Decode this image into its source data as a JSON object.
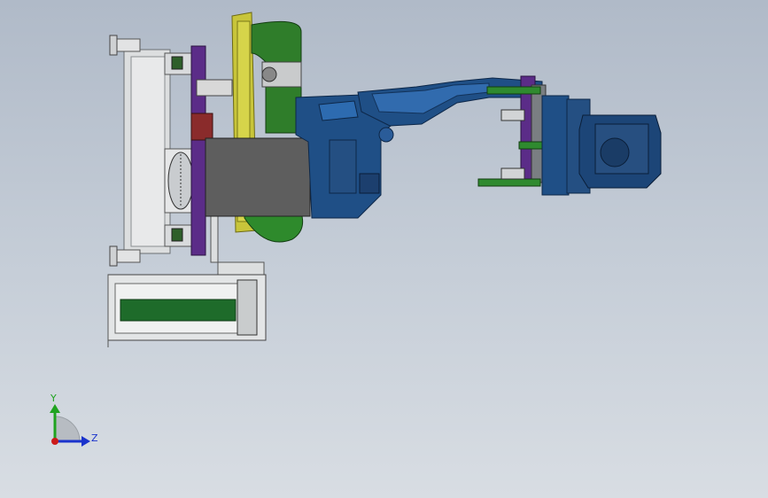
{
  "view": {
    "background_top": "#b0bac8",
    "background_bottom": "#d8dde3"
  },
  "triad": {
    "y_label": "Y",
    "z_label": "Z",
    "y_color": "#1fa31f",
    "z_color": "#1a33cc",
    "x_color": "#cc1a1a"
  },
  "colors": {
    "robot_blue": "#1f4f86",
    "gray_box": "#5e5e5e",
    "yellow_ring": "#c8c53a",
    "green_drum": "#2f7d2a",
    "purple_plate": "#5b2c88",
    "frame_gray": "#d9dbdd"
  }
}
